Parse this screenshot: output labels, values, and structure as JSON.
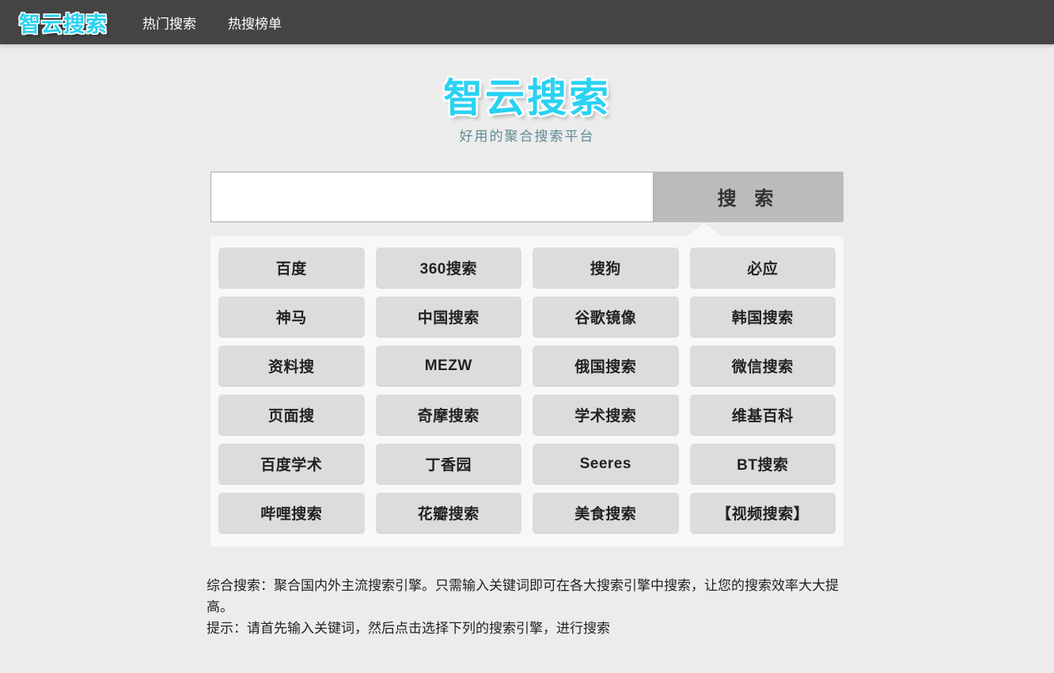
{
  "header": {
    "logo": "智云搜索",
    "nav_items": [
      {
        "label": "热门搜索"
      },
      {
        "label": "热搜榜单"
      }
    ]
  },
  "brand": {
    "title": "智云搜索",
    "subtitle": "好用的聚合搜索平台",
    "accent_color": "#2ad2f2",
    "subtitle_color": "#5f8a96"
  },
  "search": {
    "value": "",
    "placeholder": "",
    "button_label": "搜 索"
  },
  "engines": [
    {
      "label": "百度"
    },
    {
      "label": "360搜索"
    },
    {
      "label": "搜狗"
    },
    {
      "label": "必应"
    },
    {
      "label": "神马"
    },
    {
      "label": "中国搜索"
    },
    {
      "label": "谷歌镜像"
    },
    {
      "label": "韩国搜索"
    },
    {
      "label": "资料搜"
    },
    {
      "label": "MEZW"
    },
    {
      "label": "俄国搜索"
    },
    {
      "label": "微信搜索"
    },
    {
      "label": "页面搜"
    },
    {
      "label": "奇摩搜索"
    },
    {
      "label": "学术搜索"
    },
    {
      "label": "维基百科"
    },
    {
      "label": "百度学术"
    },
    {
      "label": "丁香园"
    },
    {
      "label": "Seeres"
    },
    {
      "label": "BT搜索"
    },
    {
      "label": "哔哩搜索"
    },
    {
      "label": "花瓣搜索"
    },
    {
      "label": "美食搜索"
    },
    {
      "label": "【视频搜索】"
    }
  ],
  "description": {
    "line1": "综合搜索：聚合国内外主流搜索引擎。只需输入关键词即可在各大搜索引擎中搜索，让您的搜索效率大大提高。",
    "line2": "提示：请首先输入关键词，然后点击选择下列的搜索引擎，进行搜索"
  },
  "theme": {
    "nav_background": "#444444",
    "page_background": "#ececec",
    "panel_background": "#f8f8f8",
    "engine_button_background": "#dcdcdc",
    "search_button_background": "#bbbbbb"
  }
}
